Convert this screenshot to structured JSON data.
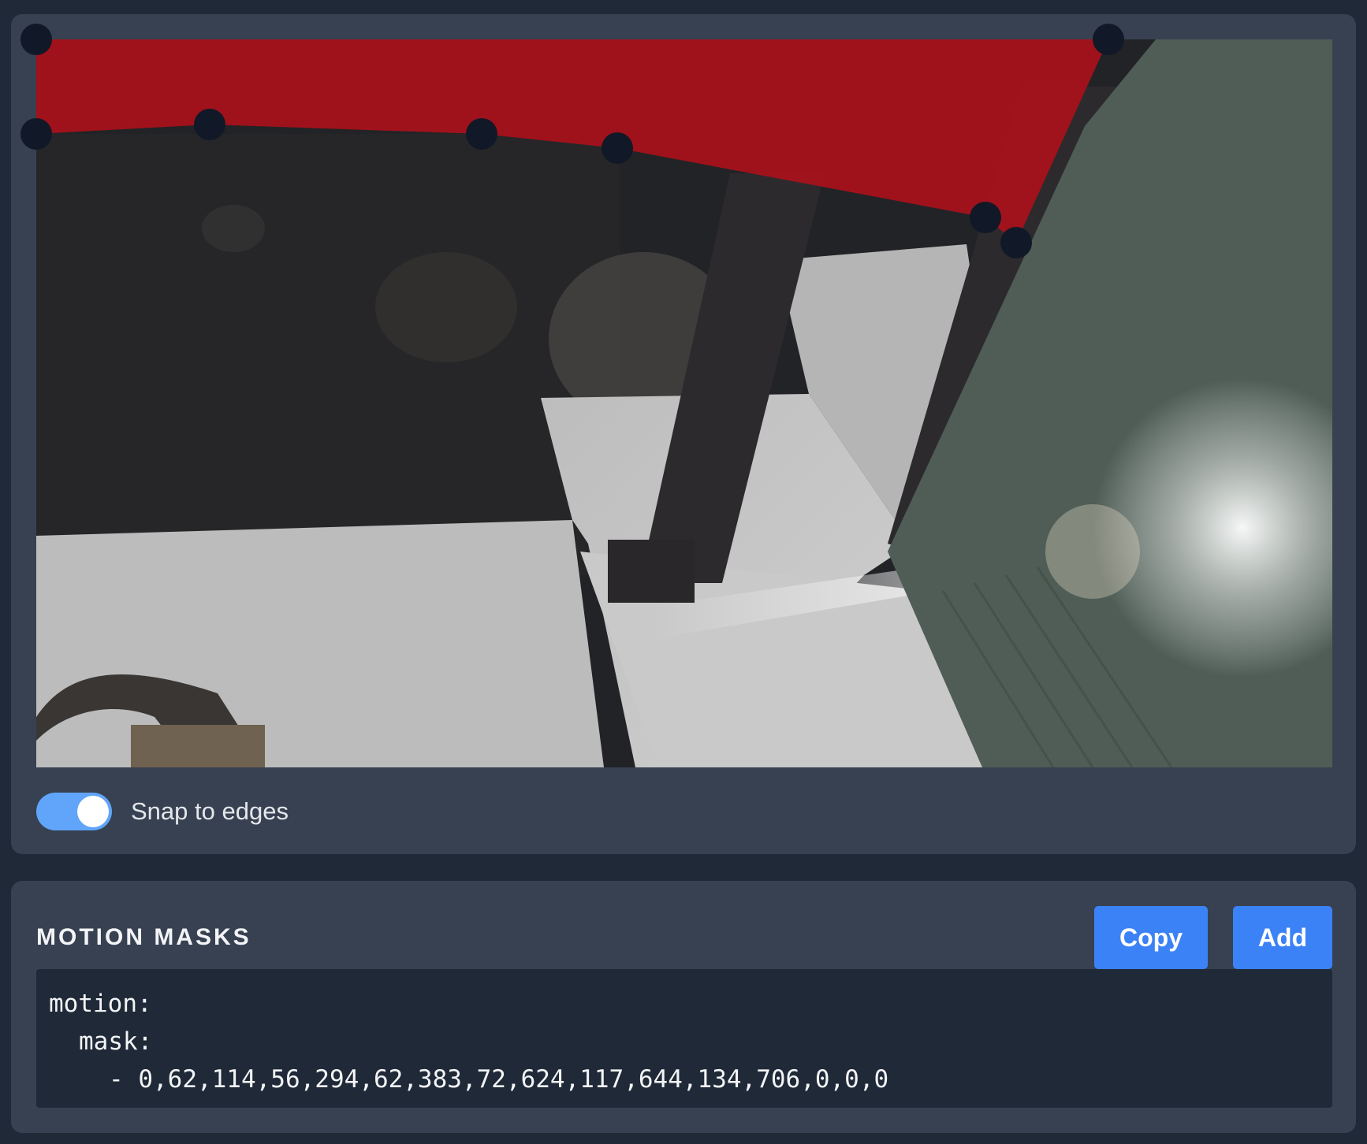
{
  "editor": {
    "snap_toggle": {
      "label": "Snap to edges",
      "on": true
    }
  },
  "masks": {
    "title": "MOTION MASKS",
    "copy_label": "Copy",
    "add_label": "Add",
    "config": {
      "line1": "motion:",
      "line2": "mask:",
      "line3": "- 0,62,114,56,294,62,383,72,624,117,644,134,706,0,0,0"
    }
  },
  "colors": {
    "mask_fill": "#b0101a",
    "handle": "#111827",
    "accent": "#3b82f6",
    "toggle_on": "#60a5fa"
  }
}
